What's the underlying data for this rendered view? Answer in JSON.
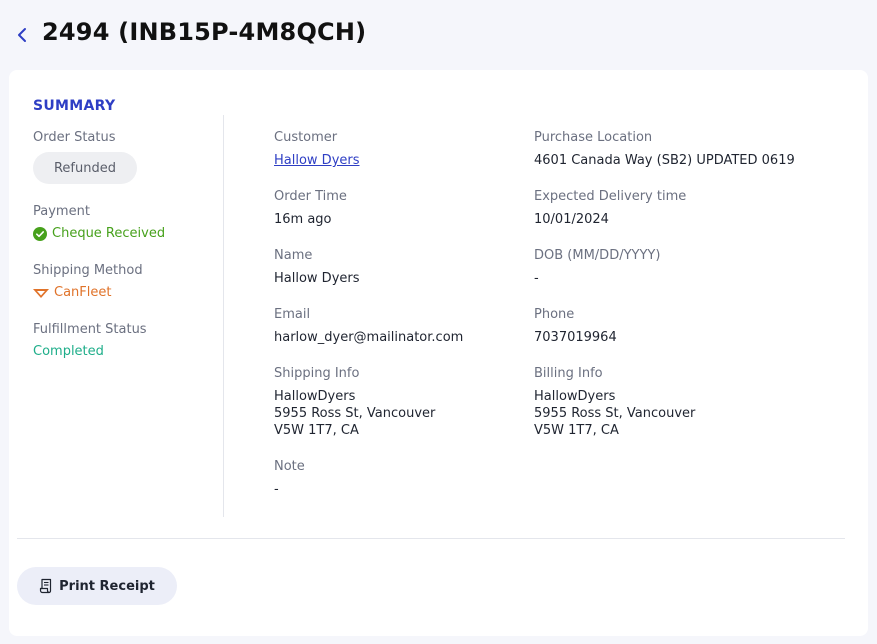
{
  "header": {
    "title": "2494 (INB15P-4M8QCH)"
  },
  "summary": {
    "title": "SUMMARY",
    "order_status": {
      "label": "Order Status",
      "value": "Refunded"
    },
    "payment": {
      "label": "Payment",
      "value": "Cheque Received",
      "icon": "check-circle-icon",
      "color": "#47a11c"
    },
    "shipping_method": {
      "label": "Shipping Method",
      "value": "CanFleet",
      "icon": "canfleet-logo-icon",
      "color": "#e0732a"
    },
    "fulfillment_status": {
      "label": "Fulfillment Status",
      "value": "Completed",
      "color": "#1fae8a"
    }
  },
  "details": {
    "customer": {
      "label": "Customer",
      "value": "Hallow Dyers"
    },
    "purchase_location": {
      "label": "Purchase Location",
      "value": "4601 Canada Way (SB2) UPDATED 0619"
    },
    "order_time": {
      "label": "Order Time",
      "value": "16m ago"
    },
    "expected_delivery": {
      "label": "Expected Delivery time",
      "value": "10/01/2024"
    },
    "name": {
      "label": "Name",
      "value": "Hallow Dyers"
    },
    "dob": {
      "label": "DOB (MM/DD/YYYY)",
      "value": "-"
    },
    "email": {
      "label": "Email",
      "value": "harlow_dyer@mailinator.com"
    },
    "phone": {
      "label": "Phone",
      "value": "7037019964"
    },
    "shipping_info": {
      "label": "Shipping Info",
      "lines": [
        "HallowDyers",
        "5955 Ross St, Vancouver",
        "V5W 1T7, CA"
      ]
    },
    "billing_info": {
      "label": "Billing Info",
      "lines": [
        "HallowDyers",
        "5955 Ross St, Vancouver",
        "V5W 1T7, CA"
      ]
    },
    "note": {
      "label": "Note",
      "value": "-"
    }
  },
  "actions": {
    "print_receipt": "Print Receipt"
  },
  "colors": {
    "accent": "#2e3ec4",
    "background": "#f5f6fb",
    "card": "#ffffff"
  }
}
